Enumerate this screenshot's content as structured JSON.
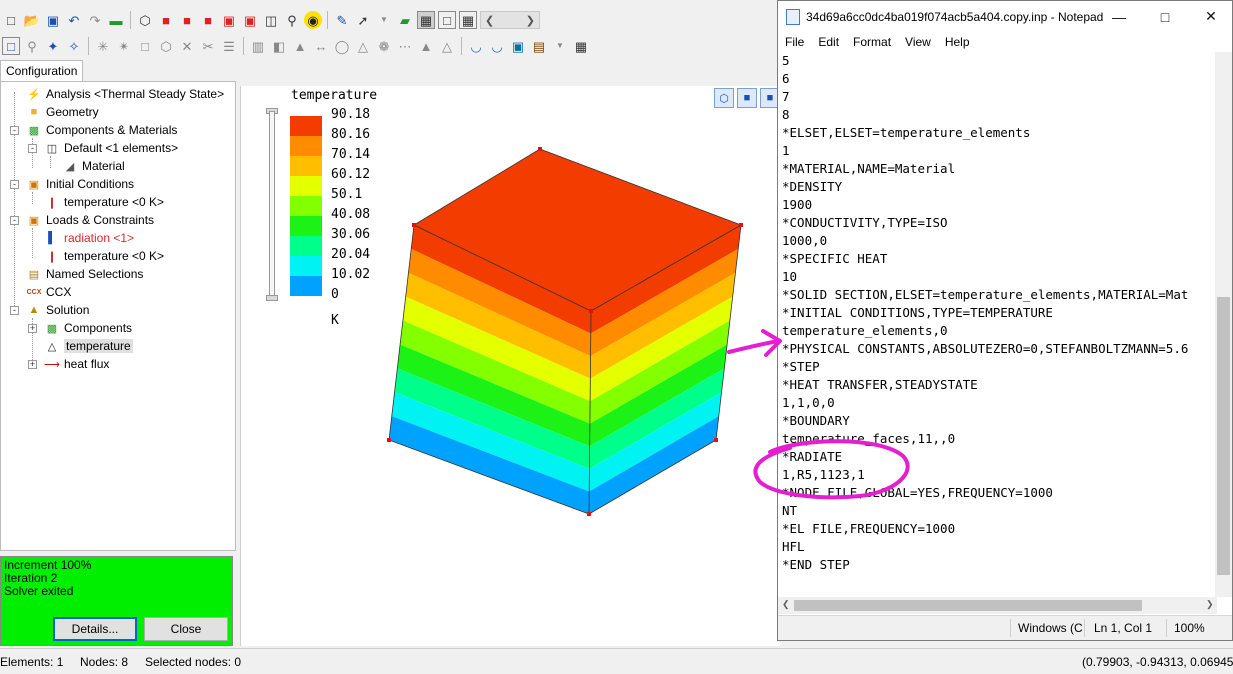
{
  "toolbar": {
    "row1_icons": [
      "new-file-icon",
      "open-folder-icon",
      "save-icon",
      "undo-icon",
      "redo-icon",
      "equals-icon",
      "wire-cube-icon",
      "red-cube-icon",
      "red-cube-front-icon",
      "red-cube-top-icon",
      "red-cube-left-icon",
      "red-cube-right-icon",
      "zoom-box-icon",
      "zoom-icon",
      "fit-view-icon",
      "paint-icon",
      "select-arrow-icon",
      "green-plane-icon",
      "view-solid-icon",
      "view-wire-icon",
      "view-mesh-icon"
    ],
    "row2_icons": [
      "select-icon",
      "lasso-icon",
      "select-edge-icon",
      "select-face-icon",
      "explode-icon",
      "explode2-icon",
      "box-icon",
      "cube-hidden-icon",
      "cross-icon",
      "cut-icon",
      "list-icon",
      "align-icon",
      "merge-icon",
      "mirror-icon",
      "distance-icon",
      "cylinder-icon",
      "cone-icon",
      "fork-icon",
      "dots-icon",
      "triangle-fill-icon",
      "triangle-icon",
      "bowl-icon",
      "bowl2-icon",
      "camera-icon",
      "film-icon",
      "table-icon"
    ]
  },
  "left_panel": {
    "tab_label": "Configuration",
    "tree": [
      {
        "label": "Analysis <Thermal Steady State>",
        "icon": "lightning-icon",
        "level": 1
      },
      {
        "label": "Geometry",
        "icon": "folder-icon",
        "level": 1
      },
      {
        "label": "Components & Materials",
        "icon": "components-icon",
        "level": 1
      },
      {
        "label": "Default <1 elements>",
        "icon": "part-icon",
        "level": 2
      },
      {
        "label": "Material",
        "icon": "material-icon",
        "level": 3
      },
      {
        "label": "Initial Conditions",
        "icon": "initial-conditions-icon",
        "level": 1
      },
      {
        "label": "temperature <0 K>",
        "icon": "thermometer-icon",
        "level": 2
      },
      {
        "label": "Loads & Constraints",
        "icon": "loads-icon",
        "level": 1
      },
      {
        "label": "radiation <1>",
        "icon": "radiation-icon",
        "level": 2,
        "highlight": true
      },
      {
        "label": "temperature <0 K>",
        "icon": "thermometer-icon",
        "level": 2
      },
      {
        "label": "Named Selections",
        "icon": "named-selections-icon",
        "level": 1
      },
      {
        "label": "CCX",
        "icon": "ccx-icon",
        "level": 1
      },
      {
        "label": "Solution",
        "icon": "solution-icon",
        "level": 1
      },
      {
        "label": "Components",
        "icon": "components-icon",
        "level": 2
      },
      {
        "label": "temperature",
        "icon": "triangle-result-icon",
        "level": 2,
        "selected": true
      },
      {
        "label": "heat flux",
        "icon": "heat-flux-icon",
        "level": 2
      }
    ]
  },
  "status_box": {
    "lines": [
      "Increment 100%",
      "Iteration 2",
      "Solver exited"
    ],
    "details_label": "Details...",
    "close_label": "Close"
  },
  "viewport": {
    "legend_title": "temperature",
    "legend_values": [
      "90.18",
      "80.16",
      "70.14",
      "60.12",
      "50.1",
      "40.08",
      "30.06",
      "20.04",
      "10.02",
      "0"
    ],
    "legend_colors": [
      "#f23c00",
      "#ff8c00",
      "#ffbf00",
      "#e3ff00",
      "#84ff00",
      "#1cf216",
      "#00ff8a",
      "#00f2f2",
      "#00a2ff",
      "#0a3cff"
    ],
    "unit": "K",
    "view_buttons": [
      "view-iso-icon",
      "view-front-icon",
      "view-side-icon"
    ]
  },
  "notepad": {
    "title": "34d69a6cc0dc4ba019f074acb5a404.copy.inp - Notepad",
    "menu": [
      "File",
      "Edit",
      "Format",
      "View",
      "Help"
    ],
    "lines": [
      "5",
      "6",
      "7",
      "8",
      "*ELSET,ELSET=temperature_elements",
      "1",
      "*MATERIAL,NAME=Material",
      "*DENSITY",
      "1900",
      "*CONDUCTIVITY,TYPE=ISO",
      "1000,0",
      "*SPECIFIC HEAT",
      "10",
      "*SOLID SECTION,ELSET=temperature_elements,MATERIAL=Mat",
      "*INITIAL CONDITIONS,TYPE=TEMPERATURE",
      "temperature_elements,0",
      "*PHYSICAL CONSTANTS,ABSOLUTEZERO=0,STEFANBOLTZMANN=5.6",
      "*STEP",
      "*HEAT TRANSFER,STEADYSTATE",
      "1,1,0,0",
      "*BOUNDARY",
      "temperature_faces,11,,0",
      "*RADIATE",
      "1,R5,1123,1",
      "*NODE FILE,GLOBAL=YES,FREQUENCY=1000",
      "NT",
      "*EL FILE,FREQUENCY=1000",
      "HFL",
      "*END STEP"
    ],
    "status": {
      "encoding": "Windows (C",
      "position": "Ln 1, Col 1",
      "zoom": "100%"
    }
  },
  "bottom_status": {
    "elements": "Elements: 1",
    "nodes": "Nodes: 8",
    "selected_nodes": "Selected nodes: 0",
    "coords": "(0.79903, -0.94313, 0.06945"
  },
  "annotation": {
    "color": "#e61ed2"
  }
}
